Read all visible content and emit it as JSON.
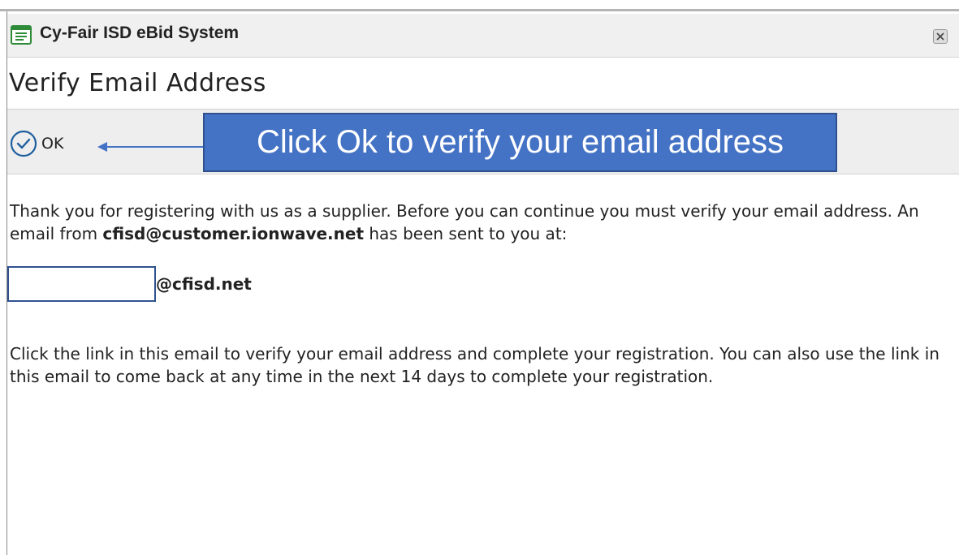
{
  "window": {
    "title": "Cy-Fair ISD eBid System",
    "icon": "list-window-icon",
    "close_icon": "close-icon"
  },
  "page": {
    "title": "Verify Email Address"
  },
  "toolbar": {
    "ok_label": "OK",
    "ok_icon": "check-circle-icon"
  },
  "callout": {
    "text": "Click Ok to verify your email address",
    "color": "#4472c4"
  },
  "body": {
    "para1_before": "Thank you for registering with us as a supplier. Before you can continue you must verify your email address. An email from ",
    "sender_email": "cfisd@customer.ionwave.net",
    "para1_after": " has been sent to you at:",
    "recipient_domain": "@cfisd.net",
    "para2": "Click the link in this email to verify your email address and complete your registration. You can also use the link in this email to come back at any time in the next 14 days to complete your registration."
  },
  "colors": {
    "accent": "#1f5f9e",
    "toolbar_bg": "#eeeeee",
    "titlebar_bg": "#f0f0f0"
  }
}
